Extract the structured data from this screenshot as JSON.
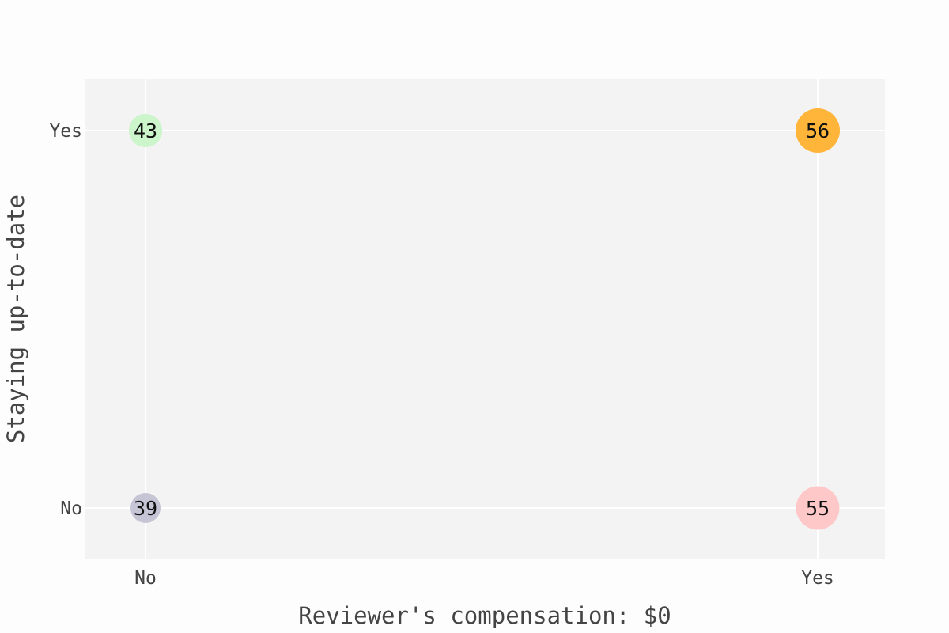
{
  "chart_data": {
    "type": "scatter",
    "xlabel": "Reviewer's compensation: $0",
    "ylabel": "Staying up-to-date",
    "x_categories": [
      "No",
      "Yes"
    ],
    "y_categories": [
      "No",
      "Yes"
    ],
    "grid": true,
    "points": [
      {
        "x": "No",
        "y": "Yes",
        "value": 43,
        "color": "#ccf5cc"
      },
      {
        "x": "Yes",
        "y": "Yes",
        "value": 56,
        "color": "#ffb53a"
      },
      {
        "x": "No",
        "y": "No",
        "value": 39,
        "color": "#c5c5d6"
      },
      {
        "x": "Yes",
        "y": "No",
        "value": 55,
        "color": "#ffc8c8"
      }
    ]
  }
}
